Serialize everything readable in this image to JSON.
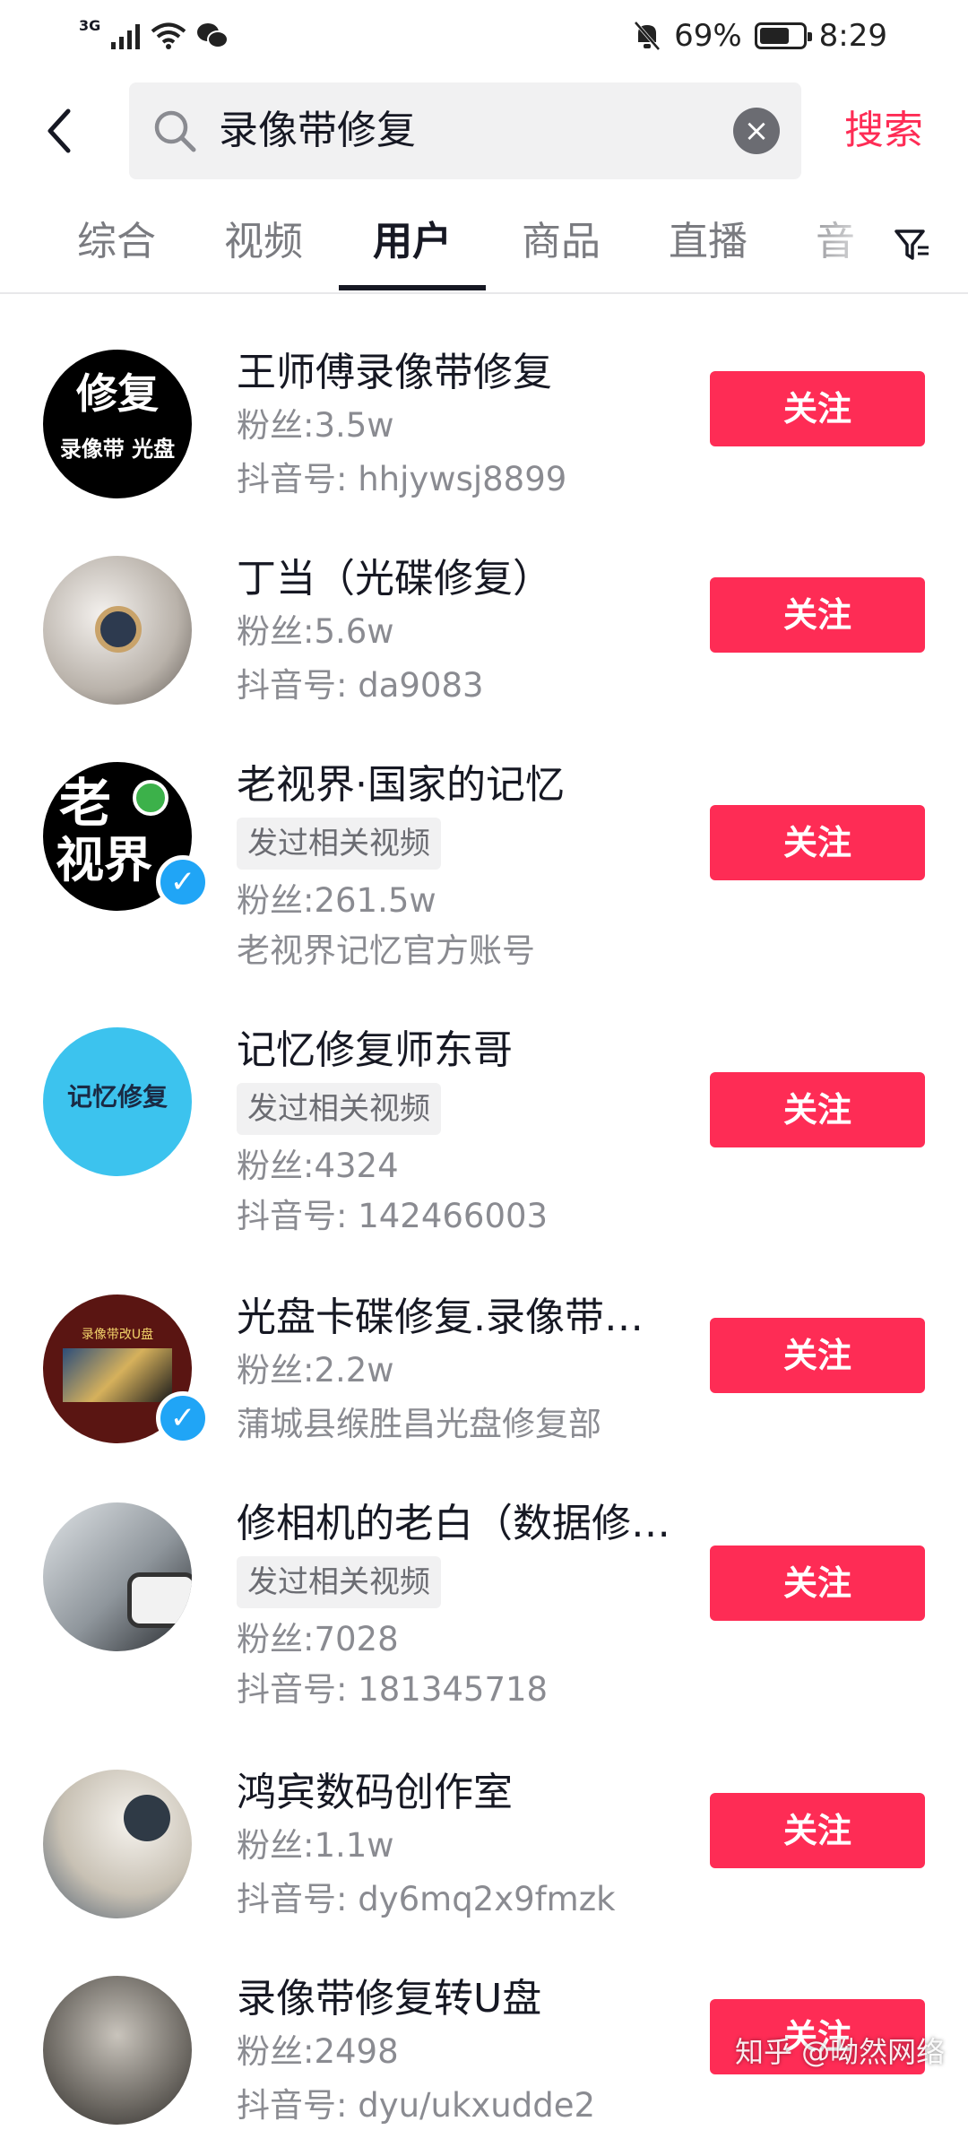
{
  "status_bar": {
    "network_type": "3G",
    "battery": "69%",
    "battery_level": 0.69,
    "time": "8:29",
    "icons": [
      "signal-icon",
      "wifi-icon",
      "wechat-icon",
      "mute-bell-icon",
      "battery-icon"
    ]
  },
  "header": {
    "back_icon": "chevron-left-icon",
    "search_icon": "search-icon",
    "search_query": "录像带修复",
    "clear_icon": "close-icon",
    "search_button": "搜索"
  },
  "tabs": {
    "items": [
      "综合",
      "视频",
      "用户",
      "商品",
      "直播",
      "音"
    ],
    "active": "用户",
    "filter_icon": "filter-icon"
  },
  "users": [
    {
      "name": "王师傅录像带修复",
      "fans": "粉丝:3.5w",
      "id": "抖音号: hhjywsj8899",
      "avatar_text": [
        "修复",
        "录像带 光盘"
      ],
      "verified": false,
      "follow": "关注"
    },
    {
      "name": "丁当（光碟修复）",
      "fans": "粉丝:5.6w",
      "id": "抖音号: da9083",
      "avatar_text": [],
      "verified": false,
      "follow": "关注"
    },
    {
      "name": "老视界·国家的记忆",
      "tag": "发过相关视频",
      "fans": "粉丝:261.5w",
      "desc": "老视界记忆官方账号",
      "avatar_text": [
        "老",
        "视界"
      ],
      "verified": true,
      "follow": "关注"
    },
    {
      "name": "记忆修复师东哥",
      "tag": "发过相关视频",
      "fans": "粉丝:4324",
      "id": "抖音号: 142466003",
      "avatar_text": [
        "记忆修复"
      ],
      "verified": false,
      "follow": "关注"
    },
    {
      "name": "光盘卡碟修复.录像带…",
      "fans": "粉丝:2.2w",
      "desc": "蒲城县缑胜昌光盘修复部",
      "avatar_text": [
        "录像带改U盘"
      ],
      "verified": true,
      "follow": "关注"
    },
    {
      "name": "修相机的老白（数据修…",
      "tag": "发过相关视频",
      "fans": "粉丝:7028",
      "id": "抖音号: 181345718",
      "avatar_text": [],
      "verified": false,
      "follow": "关注"
    },
    {
      "name": "鸿宾数码创作室",
      "fans": "粉丝:1.1w",
      "id": "抖音号: dy6mq2x9fmzk",
      "avatar_text": [],
      "verified": false,
      "follow": "关注"
    },
    {
      "name": "录像带修复转U盘",
      "fans": "粉丝:2498",
      "id": "抖音号: dyu/ukxudde2",
      "avatar_text": [],
      "verified": false,
      "follow": "关注"
    }
  ],
  "watermark": "知乎 @呦然网络",
  "colors": {
    "accent": "#fe2c55",
    "verified": "#20a5f6",
    "text_primary": "#161823",
    "text_secondary": "#8a8b91"
  }
}
